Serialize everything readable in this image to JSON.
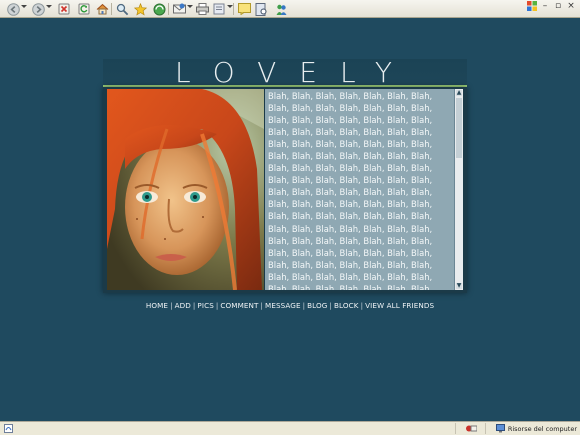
{
  "browser": {
    "toolbar_icons": [
      "back-icon",
      "forward-icon",
      "stop-icon",
      "refresh-icon",
      "home-icon",
      "search-icon",
      "favorites-icon",
      "history-icon",
      "mail-icon",
      "print-icon",
      "edit-icon",
      "discuss-icon",
      "messenger-icon"
    ],
    "status": {
      "zone_text": "Risorse del computer"
    }
  },
  "profile": {
    "title": "LOVELY",
    "blah_word": "Blah,",
    "blah_count": 184,
    "nav": [
      {
        "label": "HOME"
      },
      {
        "label": "ADD"
      },
      {
        "label": "PICS"
      },
      {
        "label": "COMMENT"
      },
      {
        "label": "MESSAGE"
      },
      {
        "label": "BLOG"
      },
      {
        "label": "BLOCK"
      },
      {
        "label": "VIEW ALL FRIENDS"
      }
    ]
  },
  "colors": {
    "background": "#1f4a5f",
    "accent_line": "#9acd79",
    "text_box": "#8fa8b3"
  }
}
